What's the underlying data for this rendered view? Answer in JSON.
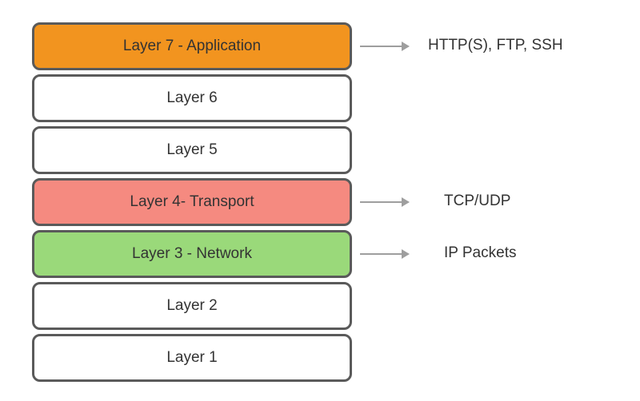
{
  "layers": [
    {
      "label": "Layer 7 - Application",
      "color": "orange",
      "note": "HTTP(S), FTP, SSH"
    },
    {
      "label": "Layer 6",
      "color": "",
      "note": ""
    },
    {
      "label": "Layer 5",
      "color": "",
      "note": ""
    },
    {
      "label": "Layer 4- Transport",
      "color": "red",
      "note": "TCP/UDP"
    },
    {
      "label": "Layer 3 - Network",
      "color": "green",
      "note": "IP Packets"
    },
    {
      "label": "Layer 2",
      "color": "",
      "note": ""
    },
    {
      "label": "Layer 1",
      "color": "",
      "note": ""
    }
  ]
}
